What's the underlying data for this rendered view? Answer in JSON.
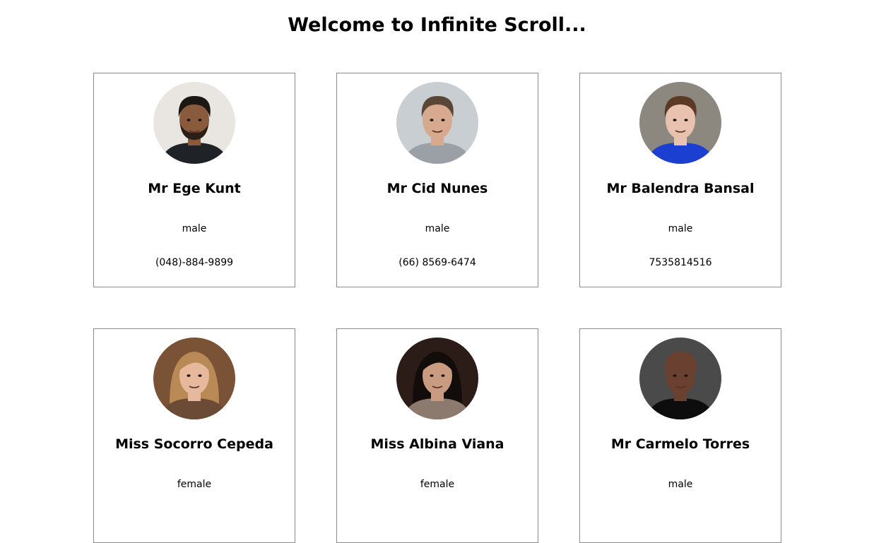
{
  "header": {
    "title": "Welcome to Infinite Scroll..."
  },
  "users": [
    {
      "name": "Mr Ege Kunt",
      "gender": "male",
      "phone": "(048)-884-9899",
      "avatar_icon": "person-photo-icon",
      "colors": {
        "bg": "#e9e6e2",
        "skin": "#8a5a3c",
        "hair": "#1b1714",
        "shirt": "#1f2327",
        "beard": "#2a1e17"
      }
    },
    {
      "name": "Mr Cid Nunes",
      "gender": "male",
      "phone": "(66) 8569-6474",
      "avatar_icon": "person-photo-icon",
      "colors": {
        "bg": "#c9ced3",
        "skin": "#d7a98e",
        "hair": "#5a4636",
        "shirt": "#9aa0a6",
        "beard": "#d7a98e"
      }
    },
    {
      "name": "Mr Balendra Bansal",
      "gender": "male",
      "phone": "7535814516",
      "avatar_icon": "person-photo-icon",
      "colors": {
        "bg": "#8c877f",
        "skin": "#e8c2ae",
        "hair": "#5b3a25",
        "shirt": "#1a3fd1",
        "beard": "#e8c2ae"
      }
    },
    {
      "name": "Miss Socorro Cepeda",
      "gender": "female",
      "phone": "",
      "avatar_icon": "person-photo-icon",
      "colors": {
        "bg": "#7a5236",
        "skin": "#e7b99c",
        "hair": "#b98a55",
        "shirt": "#6b4a36",
        "beard": "#e7b99c"
      }
    },
    {
      "name": "Miss Albina Viana",
      "gender": "female",
      "phone": "",
      "avatar_icon": "person-photo-icon",
      "colors": {
        "bg": "#2b1c17",
        "skin": "#c99c82",
        "hair": "#120d0b",
        "shirt": "#8d7a6f",
        "beard": "#c99c82"
      }
    },
    {
      "name": "Mr Carmelo Torres",
      "gender": "male",
      "phone": "",
      "avatar_icon": "person-photo-icon",
      "colors": {
        "bg": "#4a4a4a",
        "skin": "#6a4130",
        "hair": "#6a4130",
        "shirt": "#0d0d0d",
        "beard": "#6a4130"
      }
    }
  ]
}
